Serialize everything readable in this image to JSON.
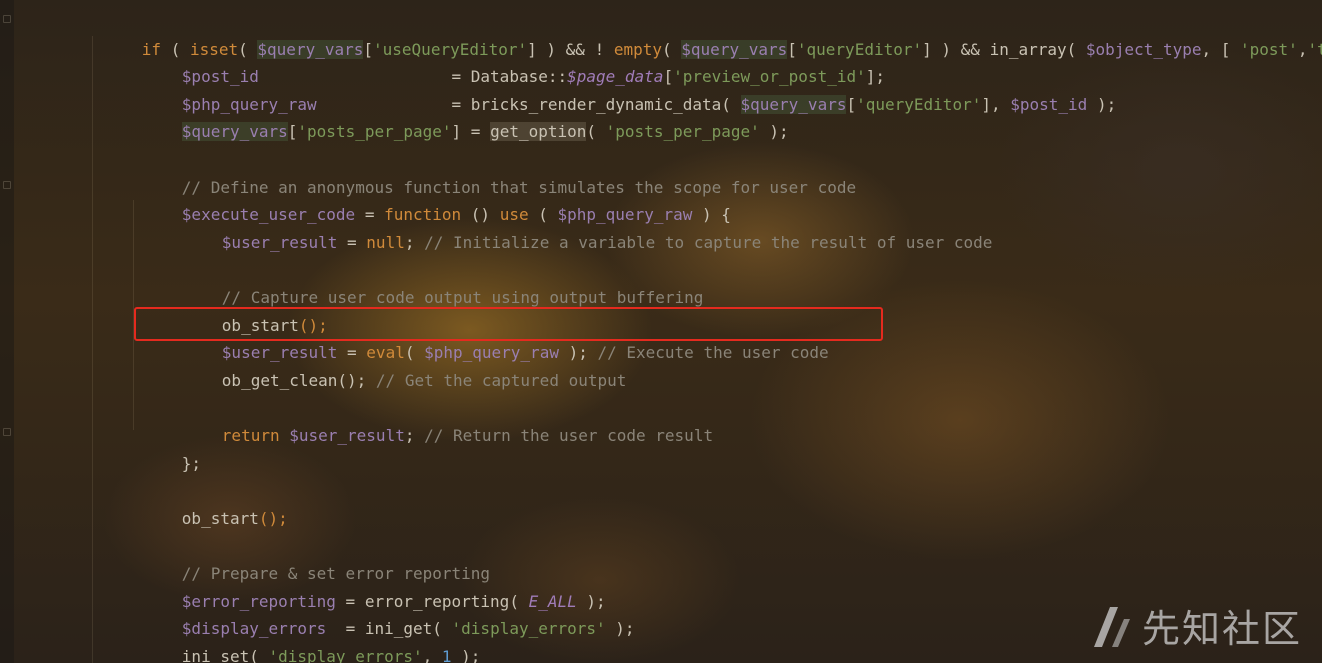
{
  "watermark": {
    "text": "先知社区",
    "icon": "xianzhi-logo-icon"
  },
  "colors": {
    "highlight_box": "#e52a1e",
    "keyword": "#d08a3a",
    "variable": "#9a7fb0",
    "string": "#7d9a5a",
    "comment": "#8a8478",
    "number": "#5f9bd0"
  },
  "code": {
    "l1": {
      "a": "if",
      "b": " ( ",
      "c": "isset",
      "d": "( ",
      "e": "$query_vars",
      "f": "[",
      "g": "'useQueryEditor'",
      "h": "] ) && ! ",
      "i": "empty",
      "j": "( ",
      "k": "$query_vars",
      "l": "[",
      "m": "'queryEditor'",
      "n": "] ) && ",
      "o": "in_array",
      "p": "( ",
      "q": "$object_type",
      "r": ", [ ",
      "s": "'post'",
      "t": ",",
      "u": "'te"
    },
    "l2": {
      "a": "$post_id",
      "b": "                    = Database::",
      "c": "$page_data",
      "d": "[",
      "e": "'preview_or_post_id'",
      "f": "];"
    },
    "l3": {
      "a": "$php_query_raw",
      "b": "              = bricks_render_dynamic_data( ",
      "c": "$query_vars",
      "d": "[",
      "e": "'queryEditor'",
      "f": "], ",
      "g": "$post_id",
      "h": " );"
    },
    "l4": {
      "a": "$query_vars",
      "b": "[",
      "c": "'posts_per_page'",
      "d": "] = ",
      "e": "get_option",
      "f": "( ",
      "g": "'posts_per_page'",
      "h": " );"
    },
    "l6": {
      "a": "// Define an anonymous function that simulates the scope for user code"
    },
    "l7": {
      "a": "$execute_user_code",
      "b": " = ",
      "c": "function",
      "d": " () ",
      "e": "use",
      "f": " ( ",
      "g": "$php_query_raw",
      "h": " ) {"
    },
    "l8": {
      "a": "$user_result",
      "b": " = ",
      "c": "null",
      "d": "; ",
      "e": "// Initialize a variable to capture the result of user code"
    },
    "l10": {
      "a": "// Capture user code output using output buffering"
    },
    "l11": {
      "a": "ob_start",
      "b": "();"
    },
    "l12": {
      "a": "$user_result",
      "b": " = ",
      "c": "eval",
      "d": "( ",
      "e": "$php_query_raw",
      "f": " ); ",
      "g": "// Execute the user code"
    },
    "l13": {
      "a": "ob_get_clean",
      "b": "(); ",
      "c": "// Get the captured output"
    },
    "l15": {
      "a": "return",
      "b": " ",
      "c": "$user_result",
      "d": "; ",
      "e": "// Return the user code result"
    },
    "l16": {
      "a": "};"
    },
    "l18": {
      "a": "ob_start",
      "b": "();"
    },
    "l20": {
      "a": "// Prepare & set error reporting"
    },
    "l21": {
      "a": "$error_reporting",
      "b": " = error_reporting( ",
      "c": "E_ALL",
      "d": " );"
    },
    "l22": {
      "a": "$display_errors",
      "b": "  = ini_get( ",
      "c": "'display_errors'",
      "d": " );"
    },
    "l23": {
      "a": "ini_set",
      "b": "( ",
      "c": "'display_errors'",
      "d": ", ",
      "e": "1",
      "f": " );"
    }
  }
}
